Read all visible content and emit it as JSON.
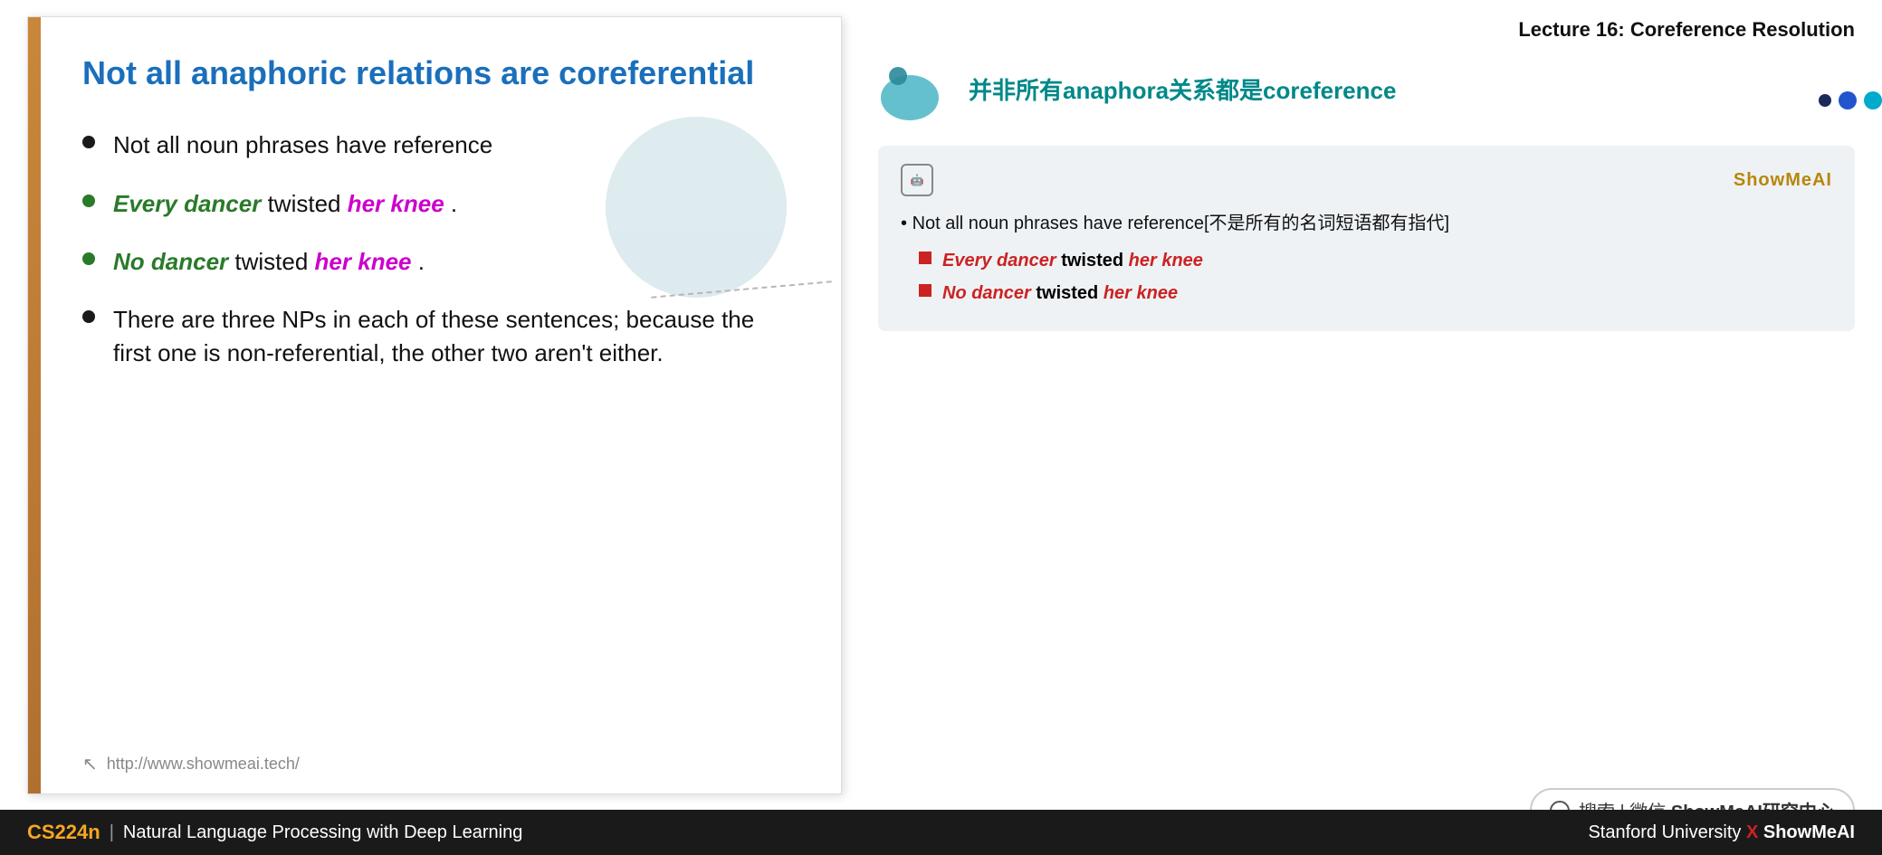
{
  "lecture": {
    "header": "Lecture 16: Coreference Resolution"
  },
  "slide": {
    "title": "Not all anaphoric relations  are coreferential",
    "left_bar_color": "#c8873a",
    "bullets": [
      {
        "id": 1,
        "type": "plain",
        "text": "Not all noun phrases have reference"
      },
      {
        "id": 2,
        "type": "colored",
        "parts": [
          "Every dancer",
          " twisted ",
          "her knee",
          "."
        ]
      },
      {
        "id": 3,
        "type": "colored",
        "parts": [
          "No dancer",
          " twisted ",
          "her knee",
          "."
        ]
      },
      {
        "id": 4,
        "type": "plain",
        "text": "There are three NPs in each of these sentences; because the first one is non-referential, the other two aren't either."
      }
    ],
    "footer_url": "http://www.showmeai.tech/"
  },
  "chinese_section": {
    "title": "并非所有anaphora关系都是coreference",
    "card": {
      "ai_icon": "AI",
      "brand": "ShowMeAI",
      "bullet1": "Not all noun phrases have reference[不是所有的名词短语都有指代]",
      "sub_bullets": [
        {
          "dancer_part": "Every dancer",
          "mid_part": " twisted ",
          "knee_part": "her knee"
        },
        {
          "dancer_part": "No dancer",
          "mid_part": " twisted ",
          "knee_part": "her knee"
        }
      ]
    }
  },
  "search": {
    "icon_label": "search",
    "text": "搜索 | 微信 ",
    "brand": "ShowMeAI研究中心"
  },
  "bottom_bar": {
    "course_code": "CS224n",
    "divider": "|",
    "course_name": "Natural Language Processing with Deep Learning",
    "right_text": "Stanford University",
    "x_mark": "X",
    "right_brand": "ShowMeAI"
  }
}
